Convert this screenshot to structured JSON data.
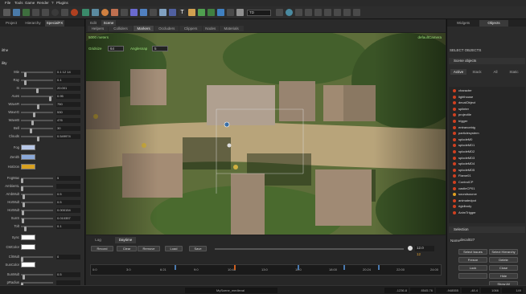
{
  "menu": {
    "items": [
      "File",
      "Tools",
      "Game",
      "Render",
      "?",
      "Plugins"
    ]
  },
  "toolbar": {
    "select_value": "TD",
    "icons": [
      "new-icon",
      "open-icon",
      "save-icon",
      "play-icon",
      "terrain-icon",
      "brush-icon",
      "sphere-icon",
      "camera-icon",
      "grid-icon",
      "text-icon",
      "settings-icon"
    ]
  },
  "left_panel": {
    "tabs": [
      "Project",
      "Hierarchy",
      "SpecialFX"
    ],
    "header": "ilthe",
    "section": "ility",
    "properties": [
      {
        "label": "Mie",
        "value": "0.1 12 14",
        "level": 0.12
      },
      {
        "label": "Ray",
        "value": "0.1",
        "level": 0.1
      },
      {
        "label": "In",
        "value": "20.001",
        "level": 0.5
      },
      {
        "label": "Aues",
        "value": "0.95",
        "level": 0.95
      },
      {
        "label": "WaveR",
        "value": "750",
        "level": 0.55
      },
      {
        "label": "WaveG",
        "value": "530",
        "level": 0.4
      },
      {
        "label": "WaveB",
        "value": "476",
        "level": 0.35
      },
      {
        "label": "Bell",
        "value": "30",
        "level": 0.3
      },
      {
        "label": "Clouds",
        "value": "0.549974",
        "level": 0.55
      }
    ],
    "colors": [
      {
        "label": "Fog",
        "color": "#b8c8e8"
      },
      {
        "label": "Zenith",
        "color": "#8aa8d8"
      },
      {
        "label": "Horizon",
        "color": "#d8a020"
      }
    ],
    "properties2": [
      {
        "label": "FogMax",
        "value": "5",
        "level": 0.0
      },
      {
        "label": "AmbientL",
        "value": "",
        "level": 0.0
      },
      {
        "label": "AmbMult",
        "value": "0.5",
        "level": 0.05
      },
      {
        "label": "HorMult",
        "value": "0.5",
        "level": 0.05
      },
      {
        "label": "HorMult",
        "value": "0.000154",
        "level": 0.03
      },
      {
        "label": "SunS",
        "value": "0.010357",
        "level": 0.03
      },
      {
        "label": "Tolt",
        "value": "0.1",
        "level": 0.1
      }
    ],
    "colors2": [
      {
        "label": "Sync",
        "color": "#ffffff"
      },
      {
        "label": "CMColor",
        "color": "#ffffff"
      },
      {
        "label": "ClrMult",
        "value": "0",
        "level": 0.0
      },
      {
        "label": "SunColor",
        "color": "#ffffff"
      },
      {
        "label": "SunMult",
        "value": "0.5",
        "level": 0.05
      },
      {
        "label": "pRadius",
        "value": "",
        "level": 0.0
      }
    ]
  },
  "viewport": {
    "tabs": [
      "Edit",
      "Scene"
    ],
    "subtabs": [
      "Helpers",
      "Colliders",
      "Markers",
      "Occluders",
      "Clippers",
      "Nodes",
      "Materials"
    ],
    "info_left": "5000 meters",
    "info_right": "defaultCamera",
    "grid_label": "Gridsize",
    "grid_value": "64",
    "angle_label": "Anglesnap",
    "angle_value": "5"
  },
  "bottom": {
    "tabs": [
      "Log",
      "Daytime"
    ],
    "buttons": [
      "Record",
      "Clear",
      "Remove",
      "Load",
      "Save"
    ],
    "time_value": "12.0",
    "time_sub": "12",
    "ticks": [
      "0:0",
      "3:0",
      "6:21",
      "9:0",
      "10:48",
      "13:0",
      "15:0",
      "18:00",
      "20:24",
      "22:00",
      "24:00"
    ],
    "markers": [
      0.24,
      0.41,
      0.59,
      0.72,
      0.82
    ]
  },
  "status": {
    "file": "MyScene_medieval",
    "coords": [
      "-1236.8",
      "8545.76",
      "-948555",
      "-48.4"
    ],
    "size": "1066",
    "count": "149"
  },
  "right_panel": {
    "tabs": [
      "Widgets",
      "Objects"
    ],
    "select_label": "SELECT OBJECTS",
    "scene_section": "Scene objects",
    "filter_tabs": [
      "Active",
      "Stack",
      "All",
      "Static"
    ],
    "objects": [
      {
        "name": "character",
        "color": "#d04020"
      },
      {
        "name": "lighthouse",
        "color": "#d04020"
      },
      {
        "name": "decalObject",
        "color": "#d04020"
      },
      {
        "name": "splinter",
        "color": "#d04020"
      },
      {
        "name": "projectile",
        "color": "#d04020"
      },
      {
        "name": "trigger",
        "color": "#d04020"
      },
      {
        "name": "entrancebig",
        "color": "#d04020"
      },
      {
        "name": "particlesystem",
        "color": "#d04020"
      },
      {
        "name": "splodeM0",
        "color": "#d04020"
      },
      {
        "name": "splodeMD1",
        "color": "#d04020"
      },
      {
        "name": "splodeMD2",
        "color": "#d04020"
      },
      {
        "name": "splodeMD3",
        "color": "#d04020"
      },
      {
        "name": "splodeMD4",
        "color": "#d04020"
      },
      {
        "name": "splodeMD5",
        "color": "#d04020"
      },
      {
        "name": "Flame01",
        "color": "#d04020"
      },
      {
        "name": "ControlCP",
        "color": "#d04020"
      },
      {
        "name": "castleCP01",
        "color": "#d04020"
      },
      {
        "name": "soundsource",
        "color": "#e0a020"
      },
      {
        "name": "animatedpot",
        "color": "#d04020"
      },
      {
        "name": "rigidbody",
        "color": "#d04020"
      },
      {
        "name": "AnimTrigger",
        "color": "#d04020"
      }
    ],
    "selection_section": "Selection",
    "name_label": "Name",
    "name_value": "decal027",
    "buttons": [
      "Select Issues",
      "Select Hierarchy",
      "Freeze",
      "Delete",
      "Lock",
      "Close",
      "",
      "Hide",
      "Show All"
    ]
  },
  "colors": {
    "accent": "#3a6ea5",
    "panel": "#2b2b2b",
    "highlight": "#c8a040"
  }
}
